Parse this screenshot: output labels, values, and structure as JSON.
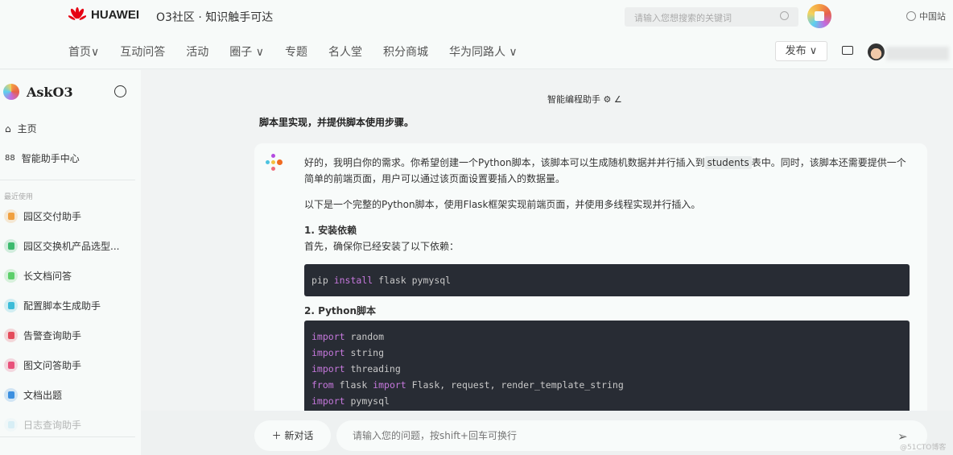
{
  "header": {
    "brand": "HUAWEI",
    "slogan": "O3社区 · 知识触手可达",
    "search_placeholder": "请输入您想搜索的关键词",
    "site": "中国站",
    "nav": [
      "首页∨",
      "互动问答",
      "活动",
      "圈子 ∨",
      "专题",
      "名人堂",
      "积分商城",
      "华为同路人 ∨"
    ],
    "publish": "发布 ∨"
  },
  "sidebar": {
    "title": "AskO3",
    "home": "主页",
    "center": "智能助手中心",
    "recent_label": "最近使用",
    "items": [
      {
        "label": "园区交付助手",
        "color": "#f0a040"
      },
      {
        "label": "园区交换机产品选型...",
        "color": "#3cba6e"
      },
      {
        "label": "长文档问答",
        "color": "#5ccf6a"
      },
      {
        "label": "配置脚本生成助手",
        "color": "#3bbcd8"
      },
      {
        "label": "告警查询助手",
        "color": "#e44b5a"
      },
      {
        "label": "图文问答助手",
        "color": "#e8507a"
      },
      {
        "label": "文档出题",
        "color": "#3b8fe0"
      },
      {
        "label": "日志查询助手",
        "color": "#9ed8ee"
      }
    ]
  },
  "chat": {
    "title": "智能编程助手",
    "user_message": "脚本里实现，并提供脚本使用步骤。",
    "answer": {
      "p1a": "好的，我明白你的需求。你希望创建一个Python脚本，该脚本可以生成随机数据并并行插入到",
      "p1code": "students",
      "p1b": "表中。同时，该脚本还需要提供一个简单的前端页面，用户可以通过该页面设置要插入的数据量。",
      "p2": "以下是一个完整的Python脚本，使用Flask框架实现前端页面，并使用多线程实现并行插入。",
      "h1": "1. 安装依赖",
      "p3": "首先，确保你已经安装了以下依赖：",
      "code1": {
        "a": "pip ",
        "kw": "install",
        "b": " flask pymysql"
      },
      "h2": "2. Python脚本",
      "code2": [
        {
          "kw": "import",
          "rest": " random"
        },
        {
          "kw": "import",
          "rest": " string"
        },
        {
          "kw": "import",
          "rest": " threading"
        },
        {
          "kw": "from",
          "rest": " flask ",
          "kw2": "import",
          "rest2": " Flask, request, render_template_string"
        },
        {
          "kw": "import",
          "rest": " pymysql"
        }
      ]
    }
  },
  "input": {
    "new_chat": "＋ 新对话",
    "placeholder": "请输入您的问题，按shift+回车可换行"
  },
  "watermark": "@51CTO博客"
}
